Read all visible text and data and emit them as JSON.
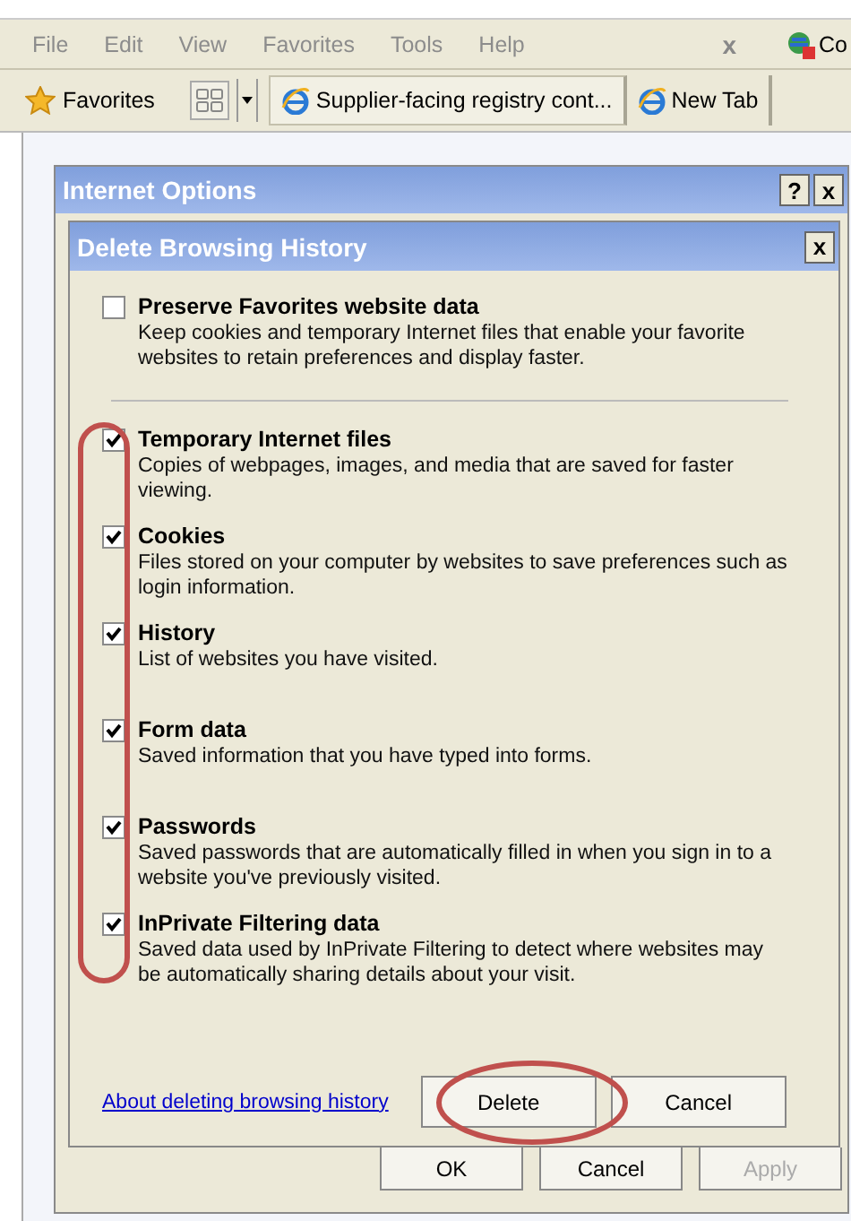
{
  "menu_bar": {
    "items": [
      "File",
      "Edit",
      "View",
      "Favorites",
      "Tools",
      "Help"
    ],
    "close_label": "x",
    "cut_label": "Co"
  },
  "favorites_bar": {
    "favorites_label": "Favorites",
    "tabs": [
      {
        "label": "Supplier-facing registry cont...",
        "selected": true
      },
      {
        "label": "New Tab",
        "selected": false
      }
    ]
  },
  "internet_options": {
    "title": "Internet Options",
    "help_label": "?",
    "close_label": "x",
    "buttons": [
      {
        "label": "OK",
        "disabled": false
      },
      {
        "label": "Cancel",
        "disabled": false
      },
      {
        "label": "Apply",
        "disabled": true
      }
    ]
  },
  "dialog": {
    "title": "Delete Browsing History",
    "close_label": "x",
    "options": [
      {
        "title": "Preserve Favorites website data",
        "description": "Keep cookies and temporary Internet files that enable your favorite websites to retain preferences and display faster.",
        "checked": false
      },
      {
        "title": "Temporary Internet files",
        "description": "Copies of webpages, images, and media that are saved for faster viewing.",
        "checked": true
      },
      {
        "title": "Cookies",
        "description": "Files stored on your computer by websites to save preferences such as login information.",
        "checked": true
      },
      {
        "title": "History",
        "description": "List of websites you have visited.",
        "checked": true
      },
      {
        "title": "Form data",
        "description": "Saved information that you have typed into forms.",
        "checked": true
      },
      {
        "title": "Passwords",
        "description": "Saved passwords that are automatically filled in when you sign in to a website you've previously visited.",
        "checked": true
      },
      {
        "title": "InPrivate Filtering data",
        "description": "Saved data used by InPrivate Filtering to detect where websites may be automatically sharing details about your visit.",
        "checked": true
      }
    ],
    "link": "About deleting browsing history",
    "buttons": [
      "Delete",
      "Cancel"
    ]
  }
}
